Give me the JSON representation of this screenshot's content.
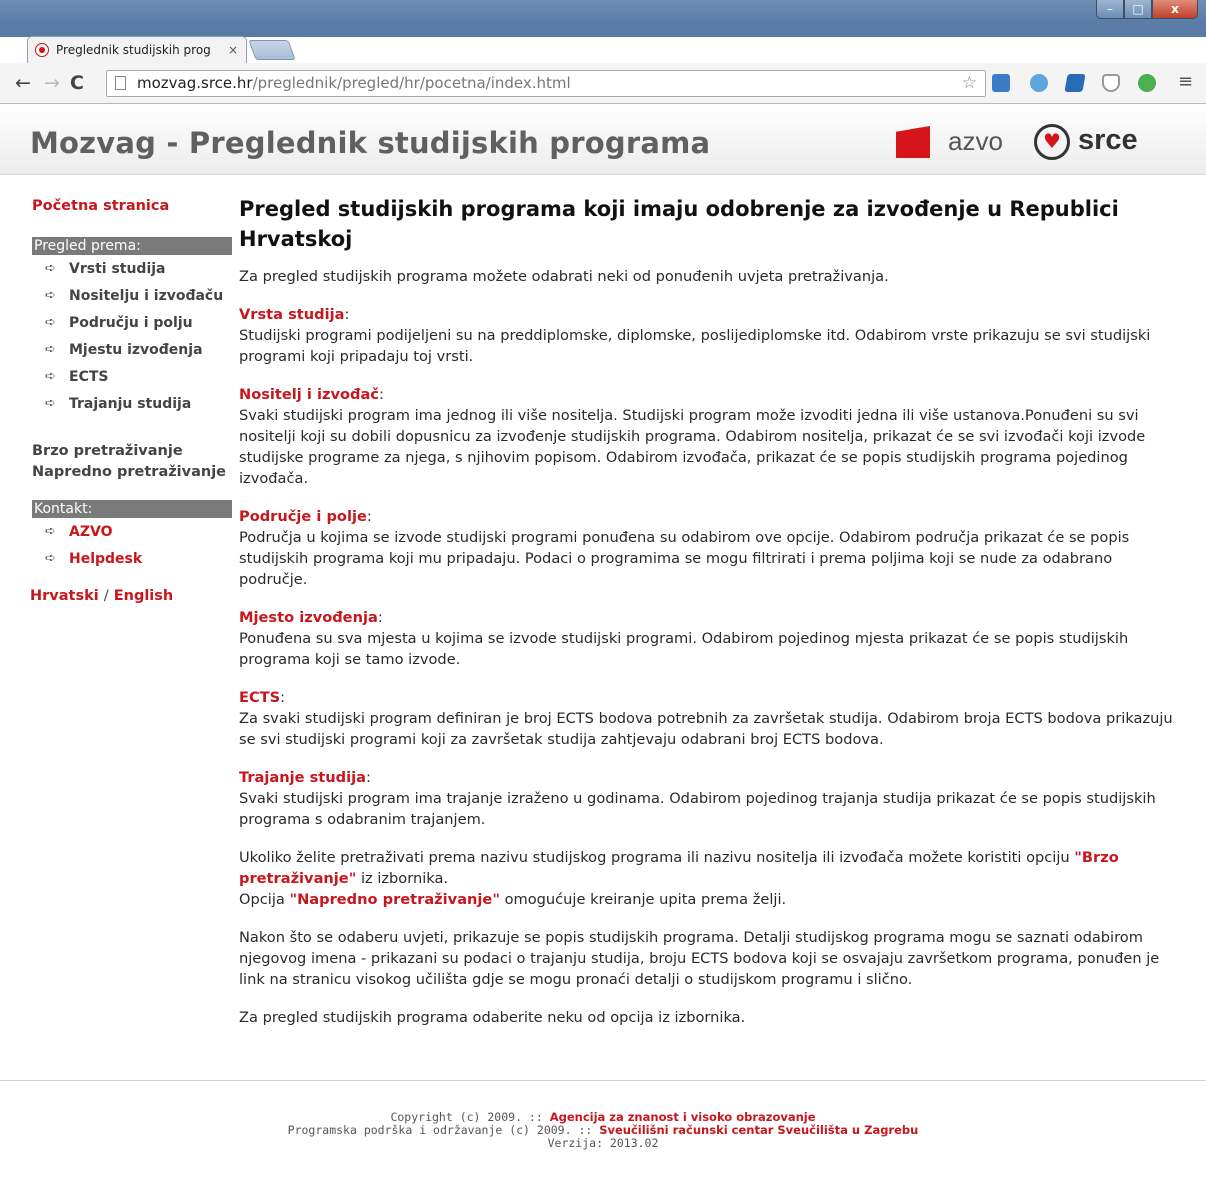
{
  "browser": {
    "tab_title": "Preglednik studijskih prog",
    "tab_close": "×",
    "url_host": "mozvag.srce.hr",
    "url_path": "/preglednik/pregled/hr/pocetna/index.html",
    "window_controls": {
      "minimize": "–",
      "maximize": "□",
      "close": "x"
    },
    "nav": {
      "back": "←",
      "forward": "→",
      "reload": "C"
    },
    "extension_icons": [
      "photo-icon",
      "viber-icon",
      "cube-icon",
      "shield-icon",
      "android-icon"
    ]
  },
  "header": {
    "site_title": "Mozvag - Preglednik studijskih programa",
    "logo_azvo": "azvo",
    "logo_srce": "srce"
  },
  "sidebar": {
    "home": "Početna stranica",
    "browse_by": "Pregled prema:",
    "browse_items": [
      "Vrsti studija",
      "Nositelju i izvođaču",
      "Području i polju",
      "Mjestu izvođenja",
      "ECTS",
      "Trajanju studija"
    ],
    "quick_search": "Brzo pretraživanje",
    "advanced_search": "Napredno pretraživanje",
    "contact_header": "Kontakt:",
    "contact_items": [
      "AZVO",
      "Helpdesk"
    ],
    "lang_hr": "Hrvatski",
    "lang_sep": "/",
    "lang_en": "English"
  },
  "main": {
    "heading": "Pregled studijskih programa koji imaju odobrenje za izvođenje u Republici Hrvatskoj",
    "intro": "Za pregled studijskih programa možete odabrati neki od ponuđenih uvjeta pretraživanja.",
    "sections": [
      {
        "title": "Vrsta studija",
        "text": "Studijski programi podijeljeni su na preddiplomske, diplomske, poslijediplomske itd. Odabirom vrste prikazuju se svi studijski programi koji pripadaju toj vrsti."
      },
      {
        "title": "Nositelj i izvođač",
        "text": "Svaki studijski program ima jednog ili više nositelja. Studijski program može izvoditi jedna ili više ustanova.Ponuđeni su svi nositelji koji su dobili dopusnicu za izvođenje studijskih programa. Odabirom nositelja, prikazat će se svi izvođači koji izvode studijske programe za njega, s njihovim popisom. Odabirom izvođača, prikazat će se popis studijskih programa pojedinog izvođača."
      },
      {
        "title": "Područje i polje",
        "text": "Područja u kojima se izvode studijski programi ponuđena su odabirom ove opcije. Odabirom područja prikazat će se popis studijskih programa koji mu pripadaju. Podaci o programima se mogu filtrirati i prema poljima koji se nude za odabrano područje."
      },
      {
        "title": "Mjesto izvođenja",
        "text": "Ponuđena su sva mjesta u kojima se izvode studijski programi. Odabirom pojedinog mjesta prikazat će se popis studijskih programa koji se tamo izvode."
      },
      {
        "title": "ECTS",
        "text": "Za svaki studijski program definiran je broj ECTS bodova potrebnih za završetak studija. Odabirom broja ECTS bodova prikazuju se svi studijski programi koji za završetak studija zahtjevaju odabrani broj ECTS bodova."
      },
      {
        "title": "Trajanje studija",
        "text": "Svaki studijski program ima trajanje izraženo u godinama. Odabirom pojedinog trajanja studija prikazat će se popis studijskih programa s odabranim trajanjem."
      }
    ],
    "colon": ":",
    "search_note_1": "Ukoliko želite pretraživati prema nazivu studijskog programa ili nazivu nositelja ili izvođača možete koristiti opciju",
    "search_note_link1": "\"Brzo pretraživanje\"",
    "search_note_2": " iz izbornika.",
    "search_note_3": "Opcija ",
    "search_note_link2": "\"Napredno pretraživanje\"",
    "search_note_4": " omogućuje kreiranje upita prema želji.",
    "details_note": "Nakon što se odaberu uvjeti, prikazuje se popis studijskih programa. Detalji studijskog programa mogu se saznati odabirom njegovog imena - prikazani su podaci o trajanju studija, broju ECTS bodova koji se osvajaju završetkom programa, ponuđen je link na stranicu visokog učilišta gdje se mogu pronaći detalji o studijskom programu i slično.",
    "closing": "Za pregled studijskih programa odaberite neku od opcija iz izbornika."
  },
  "footer": {
    "line1_text": "Copyright (c) 2009. :: ",
    "line1_link": "Agencija za znanost i visoko obrazovanje",
    "line2_text": "Programska podrška i održavanje (c) 2009. :: ",
    "line2_link": "Sveučilišni računski centar Sveučilišta u Zagrebu",
    "line3": "Verzija: 2013.02"
  },
  "colors": {
    "accent_red": "#c8161d",
    "sidebar_header_bg": "#7a7a7a"
  }
}
